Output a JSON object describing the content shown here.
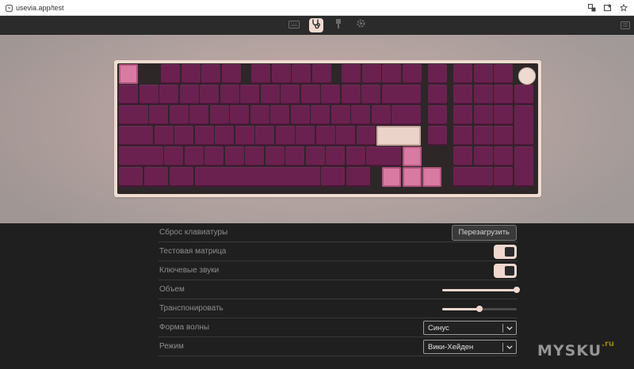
{
  "browser": {
    "url": "usevia.app/test"
  },
  "toolbar": {
    "items": [
      {
        "icon": "keyboard-icon",
        "active": false
      },
      {
        "icon": "stethoscope-icon",
        "active": true
      },
      {
        "icon": "design-icon",
        "active": false
      },
      {
        "icon": "settings-icon",
        "active": false
      }
    ]
  },
  "keyboard": {
    "key_color": "#6a2150",
    "pressed_color": "#d97aa3",
    "beige_color": "#ecd3c9",
    "case_color": "#f0dcd0"
  },
  "settings": {
    "reset": {
      "label": "Сброс клавиатуры",
      "button_label": "Перезагрузить"
    },
    "test_matrix": {
      "label": "Тестовая матрица",
      "on": true
    },
    "key_sounds": {
      "label": "Ключевые звуки",
      "on": true
    },
    "volume": {
      "label": "Объем",
      "value": 1.0
    },
    "transpose": {
      "label": "Транспонировать",
      "value": 0.5
    },
    "waveform": {
      "label": "Форма волны",
      "selected": "Синус"
    },
    "mode": {
      "label": "Режим",
      "selected": "Вики-Хейден"
    }
  },
  "watermark": {
    "text": "MYSKU",
    "suffix": ".ru"
  }
}
